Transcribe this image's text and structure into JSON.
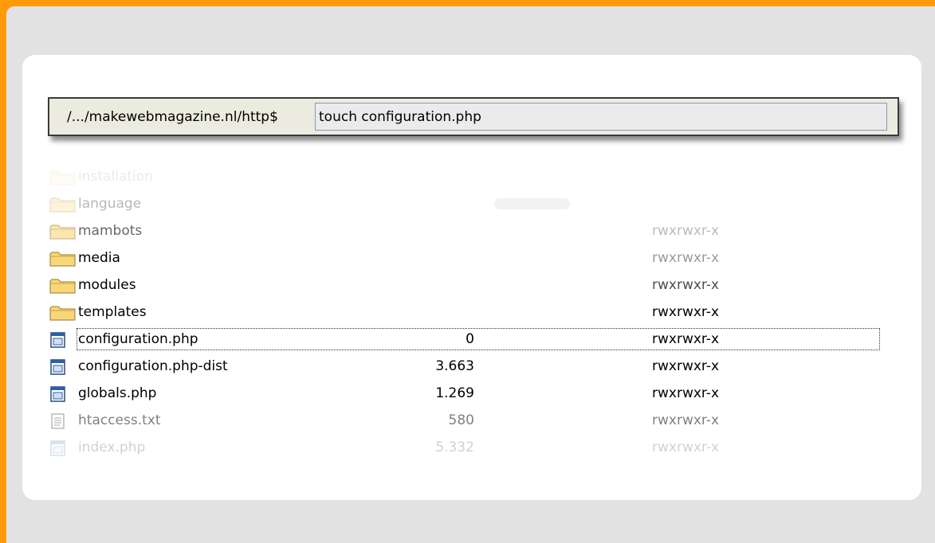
{
  "shell": {
    "prompt": "/.../makewebmagazine.nl/http$",
    "command": "touch configuration.php"
  },
  "files": [
    {
      "name": "installation",
      "size": "",
      "perm": "",
      "type": "folder"
    },
    {
      "name": "language",
      "size": "",
      "perm": "",
      "type": "folder"
    },
    {
      "name": "mambots",
      "size": "",
      "perm": "rwxrwxr-x",
      "type": "folder"
    },
    {
      "name": "media",
      "size": "",
      "perm": "rwxrwxr-x",
      "type": "folder"
    },
    {
      "name": "modules",
      "size": "",
      "perm": "rwxrwxr-x",
      "type": "folder"
    },
    {
      "name": "templates",
      "size": "",
      "perm": "rwxrwxr-x",
      "type": "folder"
    },
    {
      "name": "configuration.php",
      "size": "0",
      "perm": "rwxrwxr-x",
      "type": "php"
    },
    {
      "name": "configuration.php-dist",
      "size": "3.663",
      "perm": "rwxrwxr-x",
      "type": "php"
    },
    {
      "name": "globals.php",
      "size": "1.269",
      "perm": "rwxrwxr-x",
      "type": "php"
    },
    {
      "name": "htaccess.txt",
      "size": "580",
      "perm": "rwxrwxr-x",
      "type": "txt"
    },
    {
      "name": "index.php",
      "size": "5.332",
      "perm": "rwxrwxr-x",
      "type": "php"
    }
  ]
}
